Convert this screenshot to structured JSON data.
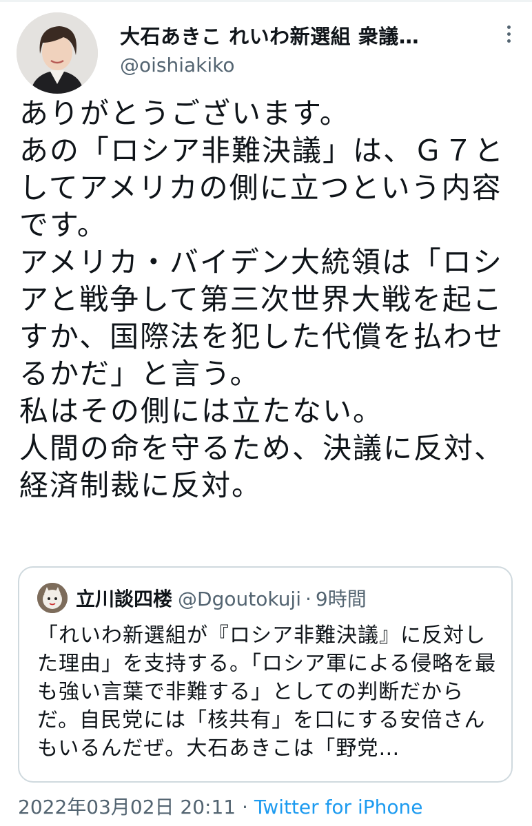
{
  "author": {
    "display_name": "大石あきこ れいわ新選組 衆議…",
    "handle": "@oishiakiko"
  },
  "tweet": {
    "text": "ありがとうございます。\nあの「ロシア非難決議」は、Ｇ７としてアメリカの側に立つという内容です。\nアメリカ・バイデン大統領は「ロシアと戦争して第三次世界大戦を起こすか、国際法を犯した代償を払わせるかだ」と言う。\n私はその側には立たない。\n人間の命を守るため、決議に反対、経済制裁に反対。"
  },
  "quoted_tweet": {
    "display_name": "立川談四楼",
    "handle": "@Dgoutokuji",
    "separator": "·",
    "time": "9時間",
    "text": "「れいわ新選組が『ロシア非難決議』に反対した理由」を支持する。「ロシア軍による侵略を最も強い言葉で非難する」としての判断だからだ。自民党には「核共有」を口にする安倍さんもいるんだぜ。大石あきこは「野党…"
  },
  "meta": {
    "timestamp": "2022年03月02日 20:11",
    "separator": "·",
    "source": "Twitter for iPhone"
  },
  "icons": {
    "more": "more-vertical-icon"
  },
  "colors": {
    "link": "#1d9bf0",
    "secondary_text": "#536471",
    "border": "#cfd9de"
  }
}
